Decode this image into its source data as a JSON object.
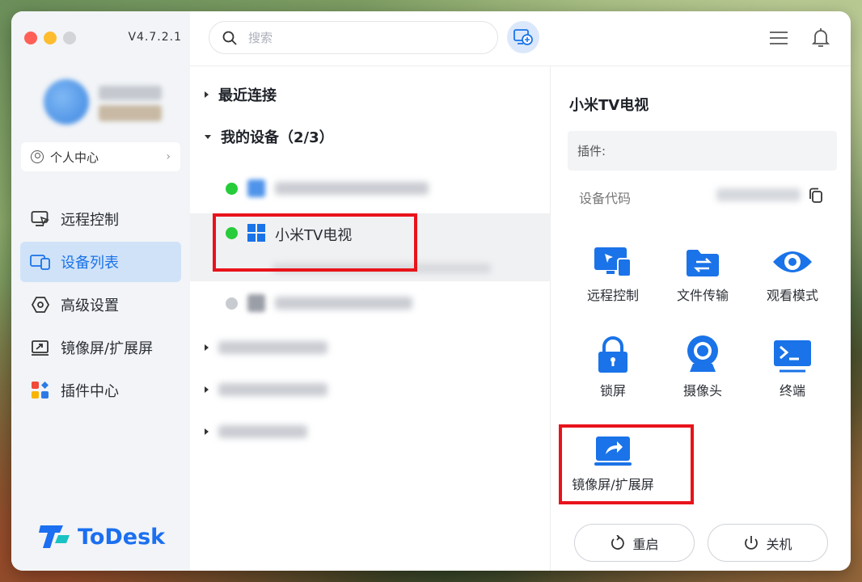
{
  "app": {
    "version": "V4.7.2.1",
    "brand": "ToDesk",
    "accent": "#1a73e8"
  },
  "profile": {
    "center_label": "个人中心"
  },
  "sidebar": {
    "items": [
      {
        "label": "远程控制",
        "icon": "remote-control-icon"
      },
      {
        "label": "设备列表",
        "icon": "device-list-icon",
        "active": true
      },
      {
        "label": "高级设置",
        "icon": "settings-icon"
      },
      {
        "label": "镜像屏/扩展屏",
        "icon": "mirror-screen-icon"
      },
      {
        "label": "插件中心",
        "icon": "plugin-center-icon"
      }
    ]
  },
  "search": {
    "placeholder": "搜索"
  },
  "devices": {
    "recent_label": "最近连接",
    "my_devices_label": "我的设备（2/3）",
    "selected_device_name": "小米TV电视"
  },
  "details": {
    "title": "小米TV电视",
    "plugin_label": "插件:",
    "device_code_label": "设备代码",
    "actions": [
      {
        "label": "远程控制",
        "icon": "remote-control-icon"
      },
      {
        "label": "文件传输",
        "icon": "file-transfer-icon"
      },
      {
        "label": "观看模式",
        "icon": "eye-icon"
      },
      {
        "label": "锁屏",
        "icon": "lock-icon"
      },
      {
        "label": "摄像头",
        "icon": "camera-icon"
      },
      {
        "label": "终端",
        "icon": "terminal-icon"
      },
      {
        "label": "镜像屏/扩展屏",
        "icon": "mirror-screen-icon"
      }
    ],
    "restart_label": "重启",
    "shutdown_label": "关机"
  }
}
